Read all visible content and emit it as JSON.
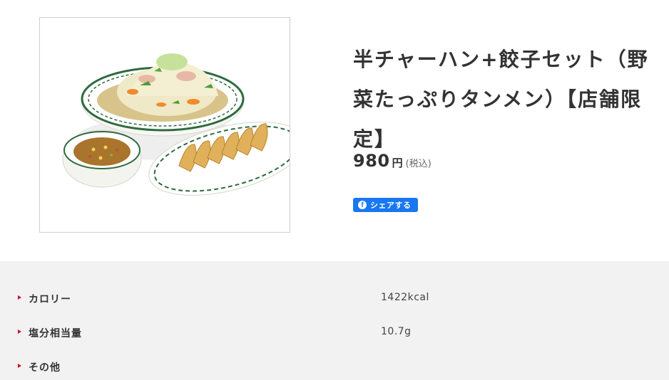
{
  "product": {
    "image_alt": "半チャーハン+餃子セット（野菜たっぷりタンメン）【店舗限定】",
    "title_line1": "半チャーハン+餃子セット（野",
    "title_line2": "菜たっぷりタンメン）【店舗限",
    "title_line3": "定】",
    "price": "980",
    "currency": "円",
    "tax_note": "(税込)"
  },
  "share": {
    "icon": "facebook-icon",
    "label": "シェアする",
    "color": "#1877f2"
  },
  "nutrition": [
    {
      "label": "カロリー",
      "value": "1422kcal"
    },
    {
      "label": "塩分相当量",
      "value": "10.7g"
    },
    {
      "label": "その他",
      "value": ""
    }
  ],
  "colors": {
    "accent_marker": "#c8102e",
    "panel_background": "#f2f2f2",
    "text": "#333333"
  }
}
